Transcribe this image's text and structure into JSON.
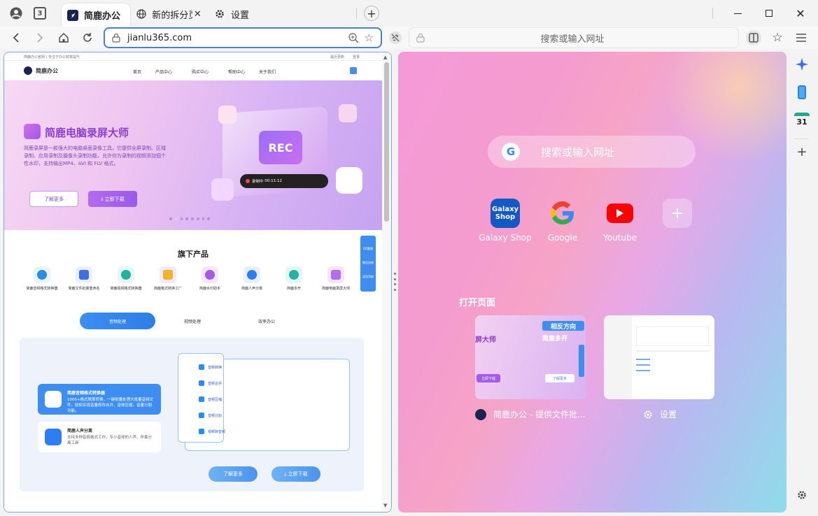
{
  "tabs": [
    {
      "title": "简鹿办公",
      "active": true
    },
    {
      "title": "新的拆分页",
      "active": false
    },
    {
      "title": "设置",
      "active": false
    }
  ],
  "tab_count": "3",
  "left_address": "jianlu365.com",
  "right_address_placeholder": "搜索或输入网址",
  "site": {
    "topstrip_left": "简鹿办公官网 | 专注于办公效率提升",
    "topstrip_right": [
      "最近更新",
      "登录"
    ],
    "logo": "简鹿办公",
    "nav": [
      "首页",
      "产品中心",
      "购买中心",
      "帮助中心",
      "关于我们"
    ],
    "hero_title": "简鹿电脑录屏大师",
    "hero_desc": "简鹿录屏是一款强大的电脑桌面录像工具，它提供全屏录制、区域录制、应用录制及摄像头录制功能，允许你为录制的视频添加個个性水印，支持输出MP4、AVI 和 FLV 格式。",
    "btn_more": "了解更多",
    "btn_download": "立即下载",
    "rec_label": "REC",
    "rec_bar": "录制中",
    "rec_time": "00:11:12",
    "products_title": "旗下产品",
    "products": [
      "简鹿音频格式转换器",
      "简鹿文件批量重命名",
      "简鹿视频格式转换器",
      "简鹿格式转换工厂",
      "简鹿水印助手",
      "简鹿人声分离",
      "简鹿多开",
      "简鹿电脑录屏大师"
    ],
    "subtabs": [
      "音频处理",
      "视频处理",
      "效率办公"
    ],
    "feature_cards": [
      {
        "title": "简鹿音频格式转换器",
        "desc": "1000+格式随意转换，一键批量处理大批量音频文件，轻松实现音量修改合并，音频压缩，音量分割功能。"
      },
      {
        "title": "简鹿人声分离",
        "desc": "支持多种音频格式工作，专小音频的人声、伴奏分离工具"
      }
    ],
    "feature_list": [
      "音频转换",
      "音频合并",
      "音频压缩",
      "音频分割",
      "视频转音频"
    ],
    "side_widget": [
      "QQ客服",
      "微信咨询",
      "返回顶部"
    ],
    "bottom_btns": [
      "了解更多",
      "立即下载"
    ]
  },
  "newtab": {
    "search_placeholder": "搜索或输入网址",
    "shortcuts": [
      {
        "name": "Galaxy Shop",
        "tile": "Galaxy Shop",
        "color": "#1259c3"
      },
      {
        "name": "Google",
        "color": "#ffffff"
      },
      {
        "name": "Youtube",
        "color": "#ffffff"
      }
    ],
    "open_pages_title": "打开页面",
    "open_pages": [
      {
        "title": "简鹿办公 - 提供文件批..."
      },
      {
        "title": "设置"
      }
    ],
    "thumb_left_texts": [
      "屏大师",
      "相反方向",
      "简鹿多开",
      "立即下载",
      "了解更多"
    ]
  },
  "sidebar": {
    "calendar_day": "31"
  }
}
